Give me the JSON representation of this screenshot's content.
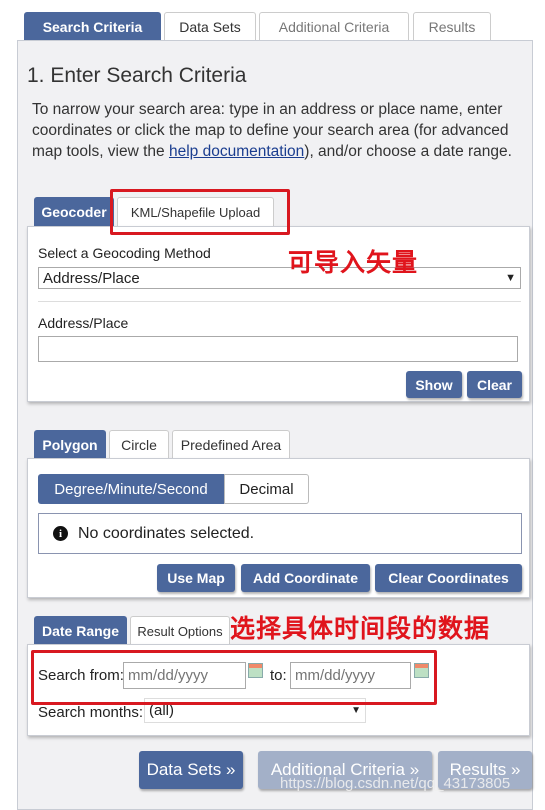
{
  "tabs": [
    {
      "label": "Search Criteria",
      "active": true
    },
    {
      "label": "Data Sets"
    },
    {
      "label": "Additional Criteria"
    },
    {
      "label": "Results"
    }
  ],
  "heading": "1. Enter Search Criteria",
  "intro": {
    "before": "To narrow your search area: type in an address or place name, enter coordinates or click the map to define your search area (for advanced map tools, view the ",
    "link": "help documentation",
    "after": "), and/or choose a date range."
  },
  "geocoder": {
    "tabs": [
      "Geocoder",
      "KML/Shapefile Upload"
    ],
    "method_label": "Select a Geocoding Method",
    "method_value": "Address/Place",
    "address_label": "Address/Place",
    "address_value": "",
    "show": "Show",
    "clear": "Clear"
  },
  "polygon": {
    "tabs": [
      "Polygon",
      "Circle",
      "Predefined Area"
    ],
    "formats": [
      "Degree/Minute/Second",
      "Decimal"
    ],
    "message": "No coordinates selected.",
    "buttons": [
      "Use Map",
      "Add Coordinate",
      "Clear Coordinates"
    ]
  },
  "date": {
    "tabs": [
      "Date Range",
      "Result Options"
    ],
    "from_label": "Search from:",
    "from_placeholder": "mm/dd/yyyy",
    "to_label": "to:",
    "to_placeholder": "mm/dd/yyyy",
    "months_label": "Search months:",
    "months_value": "(all)"
  },
  "nav": {
    "data_sets": "Data Sets »",
    "additional": "Additional Criteria »",
    "results": "Results »"
  },
  "annotations": {
    "kml": "可导入矢量",
    "date": "选择具体时间段的数据"
  },
  "watermark": "https://blog.csdn.net/qq_43173805",
  "colors": {
    "accent": "#4b679c",
    "annotation": "#d81820"
  }
}
